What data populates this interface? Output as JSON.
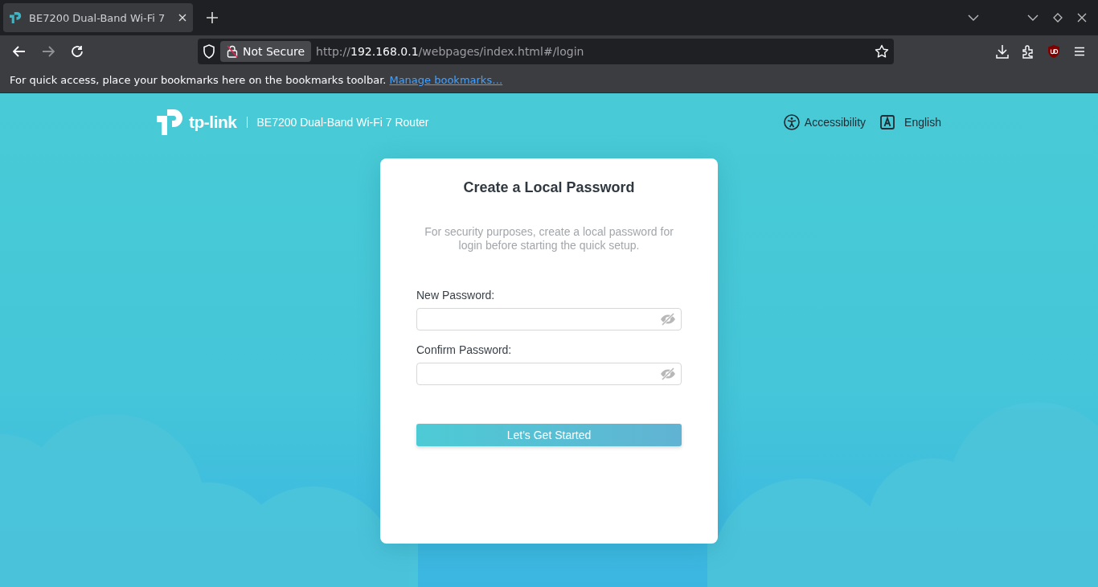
{
  "browser": {
    "tab": {
      "title": "BE7200 Dual-Band Wi-Fi 7",
      "selected": true
    },
    "address": {
      "security_label": "Not Secure",
      "scheme": "http://",
      "host": "192.168.0.1",
      "path": "/webpages/index.html#/login"
    },
    "bookmarks_bar": {
      "message": "For quick access, place your bookmarks here on the bookmarks toolbar.",
      "link": "Manage bookmarks…"
    }
  },
  "header": {
    "logo": "tp-link",
    "model": "BE7200 Dual-Band Wi-Fi 7 Router",
    "accessibility": "Accessibility",
    "language": "English"
  },
  "card": {
    "title": "Create a Local Password",
    "description": "For security purposes, create a local password for login before starting the quick setup.",
    "fields": [
      {
        "label": "New Password:"
      },
      {
        "label": "Confirm Password:"
      }
    ],
    "button": "Let's Get Started"
  }
}
